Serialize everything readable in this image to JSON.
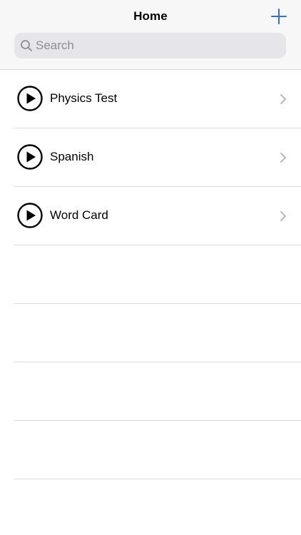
{
  "nav": {
    "title": "Home",
    "add_icon": "plus-icon",
    "accent_color": "#2f6fd6"
  },
  "search": {
    "placeholder": "Search",
    "value": "",
    "icon": "magnifying-glass-icon"
  },
  "list": {
    "items": [
      {
        "label": "Physics Test",
        "icon": "play-circle-icon",
        "accessory": "chevron-right-icon"
      },
      {
        "label": "Spanish",
        "icon": "play-circle-icon",
        "accessory": "chevron-right-icon"
      },
      {
        "label": "Word Card",
        "icon": "play-circle-icon",
        "accessory": "chevron-right-icon"
      }
    ]
  }
}
